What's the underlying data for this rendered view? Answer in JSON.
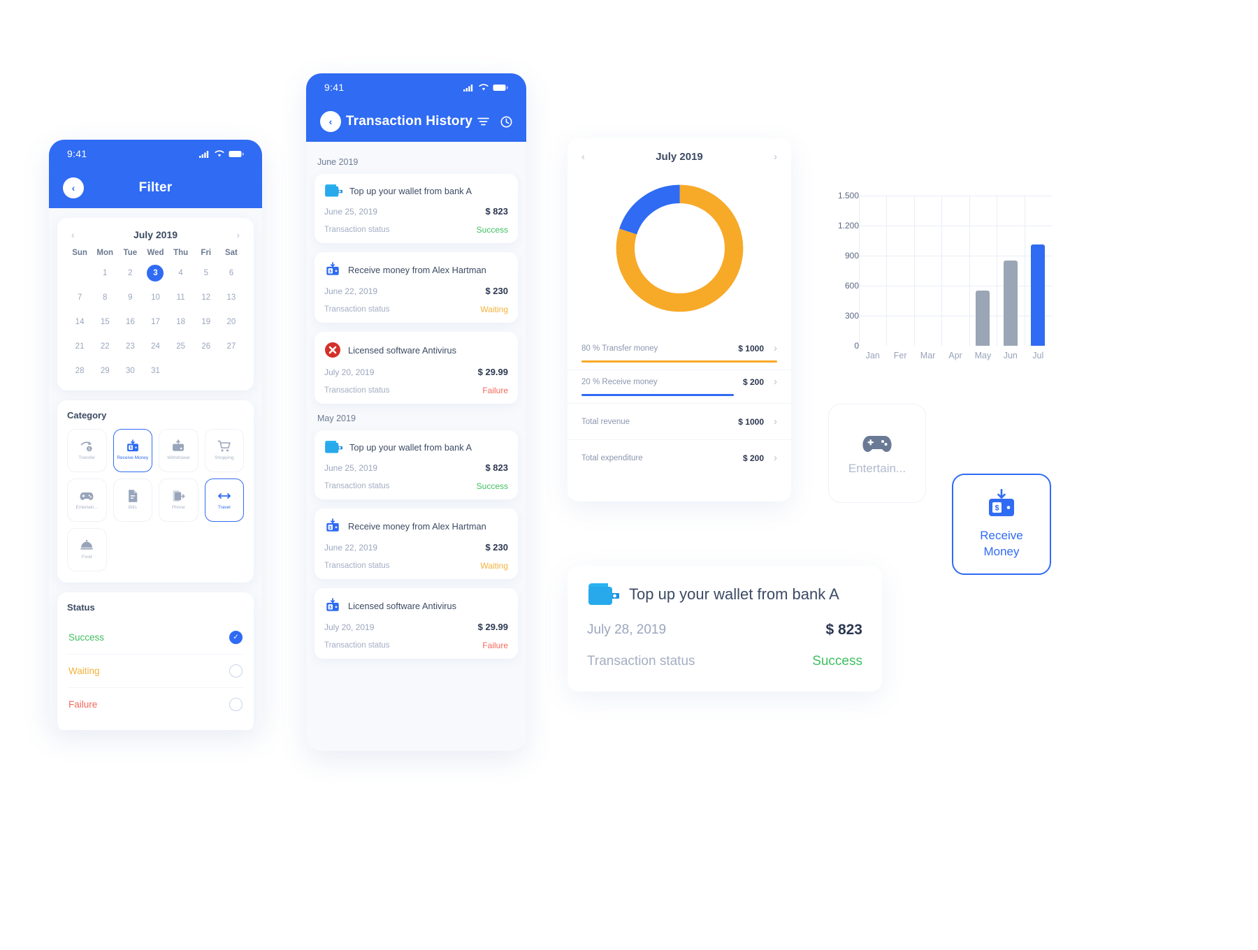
{
  "filter_screen": {
    "status_bar": {
      "time": "9:41",
      "signal": "signal-icon",
      "wifi": "wifi-icon",
      "battery": "battery-icon"
    },
    "nav": {
      "back": "‹",
      "title": "Filter"
    },
    "calendar": {
      "prev": "‹",
      "next": "›",
      "title": "July 2019",
      "dow": [
        "Sun",
        "Mon",
        "Tue",
        "Wed",
        "Thu",
        "Fri",
        "Sat"
      ],
      "blanks": 1,
      "days": [
        1,
        2,
        3,
        4,
        5,
        6,
        7,
        8,
        9,
        10,
        11,
        12,
        13,
        14,
        15,
        16,
        17,
        18,
        19,
        20,
        21,
        22,
        23,
        24,
        25,
        26,
        27,
        28,
        29,
        30,
        31
      ],
      "selected": 3
    },
    "category": {
      "title": "Category",
      "items": [
        {
          "label": "Transfer",
          "icon": "transfer-icon",
          "active": false
        },
        {
          "label": "Receive Money",
          "icon": "receive-money-icon",
          "active": true
        },
        {
          "label": "Withdrawal",
          "icon": "withdrawal-icon",
          "active": false
        },
        {
          "label": "Shopping",
          "icon": "shopping-cart-icon",
          "active": false
        },
        {
          "label": "Entertain...",
          "icon": "gamepad-icon",
          "active": false
        },
        {
          "label": "Bills",
          "icon": "document-icon",
          "active": false
        },
        {
          "label": "Phone",
          "icon": "phone-icon",
          "active": false
        },
        {
          "label": "Travel",
          "icon": "travel-icon",
          "active": true
        },
        {
          "label": "Food",
          "icon": "food-icon",
          "active": false
        }
      ]
    },
    "status": {
      "title": "Status",
      "items": [
        {
          "label": "Success",
          "color": "#3fbf62",
          "checked": true
        },
        {
          "label": "Waiting",
          "color": "#f3b23c",
          "checked": false
        },
        {
          "label": "Failure",
          "color": "#f4675a",
          "checked": false
        }
      ]
    }
  },
  "history_screen": {
    "status_bar": {
      "time": "9:41"
    },
    "nav": {
      "back": "‹",
      "title": "Transaction History",
      "filter_icon": "filter-icon",
      "history_icon": "history-clock-icon"
    },
    "groups": [
      {
        "month": "June 2019",
        "items": [
          {
            "icon": "wallet-icon",
            "title": "Top up your wallet from bank A",
            "date": "June 25, 2019",
            "amount": "$ 823",
            "status_label": "Transaction status",
            "status": "Success",
            "status_color": "#3fbf62"
          },
          {
            "icon": "receive-money-icon",
            "title": "Receive money from Alex Hartman",
            "date": "June 22, 2019",
            "amount": "$ 230",
            "status_label": "Transaction status",
            "status": "Waiting",
            "status_color": "#f3b23c"
          },
          {
            "icon": "antivirus-icon",
            "title": "Licensed software Antivirus",
            "date": "July 20, 2019",
            "amount": "$ 29.99",
            "status_label": "Transaction status",
            "status": "Failure",
            "status_color": "#f4675a"
          }
        ]
      },
      {
        "month": "May 2019",
        "items": [
          {
            "icon": "wallet-icon",
            "title": "Top up your wallet from bank A",
            "date": "June 25, 2019",
            "amount": "$ 823",
            "status_label": "Transaction status",
            "status": "Success",
            "status_color": "#3fbf62"
          },
          {
            "icon": "receive-money-icon",
            "title": "Receive money from Alex Hartman",
            "date": "June 22, 2019",
            "amount": "$ 230",
            "status_label": "Transaction status",
            "status": "Waiting",
            "status_color": "#f3b23c"
          },
          {
            "icon": "receive-money-icon",
            "title": "Licensed software Antivirus",
            "date": "July 20, 2019",
            "amount": "$ 29.99",
            "status_label": "Transaction status",
            "status": "Failure",
            "status_color": "#f4675a"
          }
        ]
      }
    ]
  },
  "analytics": {
    "prev": "‹",
    "next": "›",
    "title": "July 2019",
    "legend": [
      {
        "label": "80 % Transfer money",
        "value": "$ 1000",
        "color": "#f7a928",
        "width": 100,
        "chevron": "›"
      },
      {
        "label": "20 % Receive money",
        "value": "$ 200",
        "color": "#2f6bf3",
        "width": 78,
        "chevron": "›"
      }
    ],
    "rows": [
      {
        "label": "Total revenue",
        "value": "$ 1000",
        "chevron": "›"
      },
      {
        "label": "Total expenditure",
        "value": "$ 200",
        "chevron": "›"
      }
    ]
  },
  "chart_data": [
    {
      "type": "pie",
      "title": "July 2019",
      "labels": [
        "80 % Transfer money",
        "20 % Receive money"
      ],
      "values": [
        80,
        20
      ],
      "amounts": [
        "$ 1000",
        "$ 200"
      ],
      "colors": [
        "#f7a928",
        "#2f6bf3"
      ],
      "donut": true,
      "legend_position": "below"
    },
    {
      "type": "bar",
      "title": "",
      "categories": [
        "Jan",
        "Fer",
        "Mar",
        "Apr",
        "May",
        "Jun",
        "Jul"
      ],
      "values": [
        0,
        0,
        0,
        0,
        550,
        850,
        1010
      ],
      "colors": [
        "#9aa5b5",
        "#9aa5b5",
        "#9aa5b5",
        "#9aa5b5",
        "#9aa5b5",
        "#9aa5b5",
        "#2f6bf3"
      ],
      "yticks": [
        "0",
        "300",
        "600",
        "900",
        "1.200",
        "1.500"
      ],
      "ylim": [
        0,
        1500
      ],
      "xlabel": "",
      "ylabel": "",
      "grid": true
    }
  ],
  "entertainment_tile": {
    "label": "Entertain...",
    "icon": "gamepad-icon"
  },
  "receive_money_tile": {
    "label": "Receive\nMoney",
    "line1": "Receive",
    "line2": "Money",
    "icon": "receive-money-icon"
  },
  "detail_card": {
    "icon": "wallet-icon",
    "title": "Top up your wallet from bank A",
    "date": "July 28, 2019",
    "amount": "$ 823",
    "status_label": "Transaction status",
    "status": "Success",
    "status_color": "#3fbf62"
  }
}
